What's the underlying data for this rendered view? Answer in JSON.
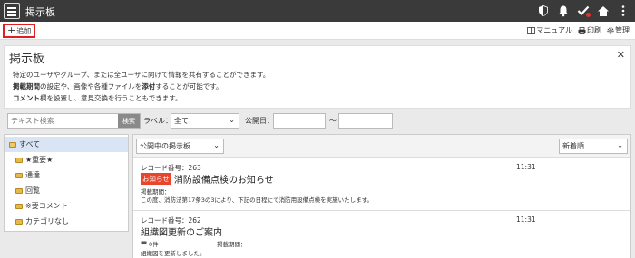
{
  "app": {
    "title": "掲示板"
  },
  "toolbar": {
    "add_label": "追加",
    "manual_label": "マニュアル",
    "print_label": "印刷",
    "manage_label": "管理"
  },
  "info": {
    "title": "掲示板",
    "line1": "特定のユーザやグループ、または全ユーザに向けて情報を共有することができます。",
    "line2_bold1": "掲載期間",
    "line2_mid": "の設定や、画像や各種ファイルを",
    "line2_bold2": "添付",
    "line2_end": "することが可能です。",
    "line3_bold": "コメント",
    "line3_end": "欄を設置し、意見交換を行うこともできます。"
  },
  "filter": {
    "search_placeholder": "テキスト検索",
    "search_button": "検索",
    "label_label": "ラベル：",
    "label_value": "全て",
    "date_label": "公開日：",
    "range_sep": "〜"
  },
  "categories": [
    {
      "label": "すべて"
    },
    {
      "label": "★重要★"
    },
    {
      "label": "通達"
    },
    {
      "label": "回覧"
    },
    {
      "label": "※要コメント"
    },
    {
      "label": "カテゴリなし"
    }
  ],
  "list": {
    "scope_select": "公開中の掲示板",
    "sort_select": "新着順"
  },
  "records": [
    {
      "record_no": "レコード番号：263",
      "time": "11:31",
      "tag": "お知らせ",
      "title": "消防設備点検のお知らせ",
      "period_label": "掲載期間：",
      "body": "この度、消防法第17条3の3により、下記の日程にて消防用設備点検を実施いたします。"
    },
    {
      "record_no": "レコード番号：262",
      "time": "11:31",
      "title": "組織図更新のご案内",
      "comment_count": "0件",
      "period_label": "掲載期間：",
      "body": "組織図を更新しました。"
    }
  ]
}
